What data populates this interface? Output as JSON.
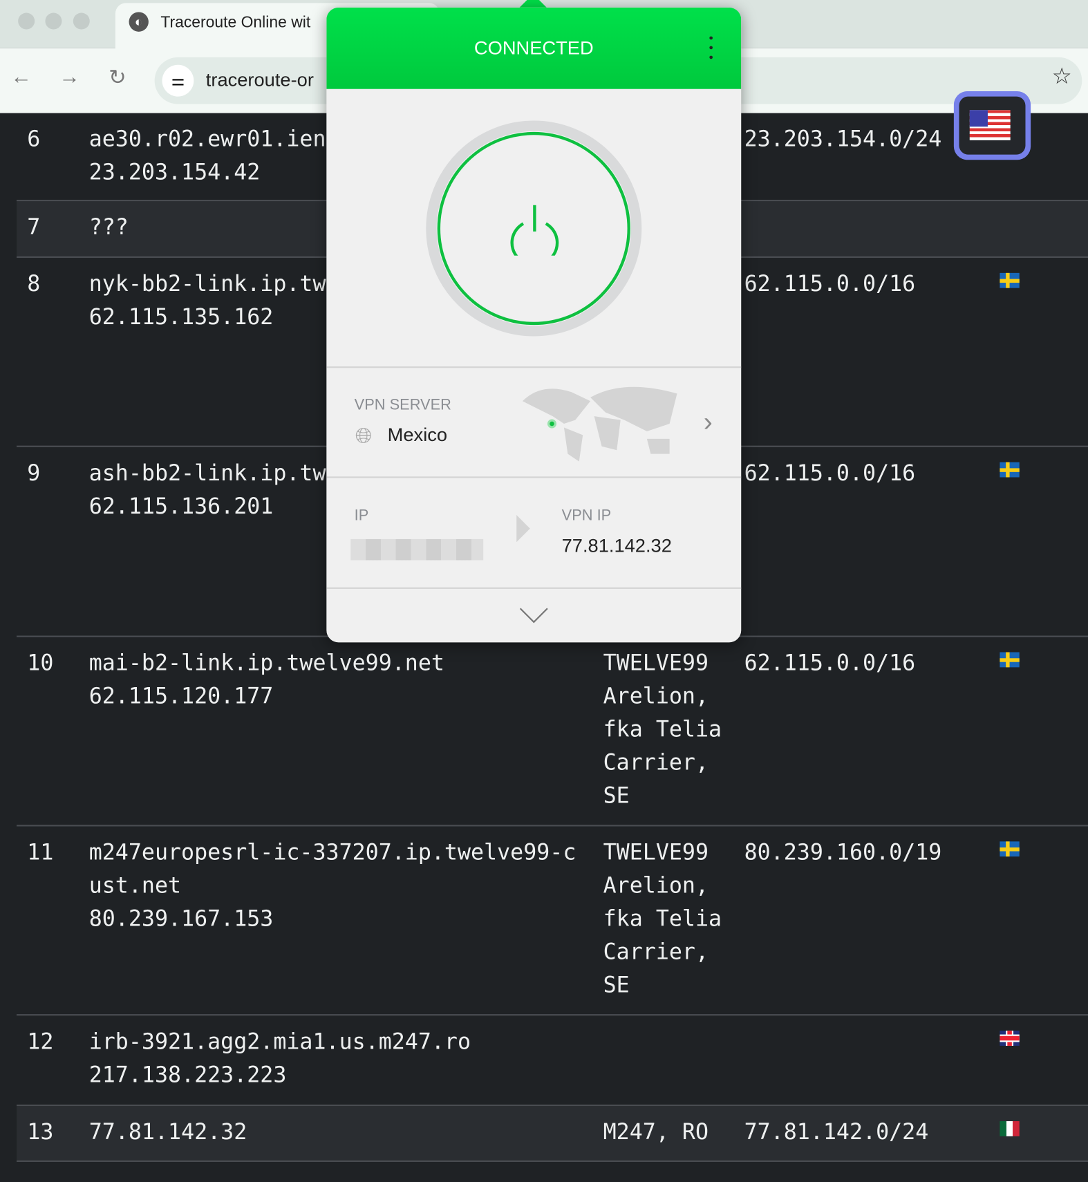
{
  "browser": {
    "tab_title": "Traceroute Online wit",
    "url": "traceroute-or"
  },
  "table": {
    "rows": [
      {
        "hop": "6",
        "host": "ae30.r02.ewr01.ien",
        "ip": "23.203.154.42",
        "asn": "",
        "net": "23.203.154.0/24",
        "flag": "us"
      },
      {
        "hop": "7",
        "host": "???",
        "ip": "",
        "asn": "",
        "net": "",
        "flag": ""
      },
      {
        "hop": "8",
        "host": "nyk-bb2-link.ip.tw",
        "ip": "62.115.135.162",
        "asn": "",
        "net": "62.115.0.0/16",
        "flag": "se"
      },
      {
        "hop": "9",
        "host": "ash-bb2-link.ip.tw",
        "ip": "62.115.136.201",
        "asn": "",
        "net": "62.115.0.0/16",
        "flag": "se"
      },
      {
        "hop": "10",
        "host": "mai-b2-link.ip.twelve99.net",
        "ip": "62.115.120.177",
        "asn": "TWELVE99 Arelion, fka Telia Carrier, SE",
        "net": "62.115.0.0/16",
        "flag": "se"
      },
      {
        "hop": "11",
        "host": "m247europesrl-ic-337207.ip.twelve99-cust.net",
        "ip": "80.239.167.153",
        "asn": "TWELVE99 Arelion, fka Telia Carrier, SE",
        "net": "80.239.160.0/19",
        "flag": "se"
      },
      {
        "hop": "12",
        "host": "irb-3921.agg2.mia1.us.m247.ro",
        "ip": "217.138.223.223",
        "asn": "",
        "net": "",
        "flag": "gb"
      },
      {
        "hop": "13",
        "host": "77.81.142.32",
        "ip": "",
        "asn": "M247, RO",
        "net": "77.81.142.0/24",
        "flag": "mx"
      }
    ]
  },
  "vpn": {
    "status": "CONNECTED",
    "server_label": "VPN SERVER",
    "server": "Mexico",
    "ip_label": "IP",
    "vpn_ip_label": "VPN IP",
    "vpn_ip": "77.81.142.32",
    "accent": "#00d143"
  }
}
